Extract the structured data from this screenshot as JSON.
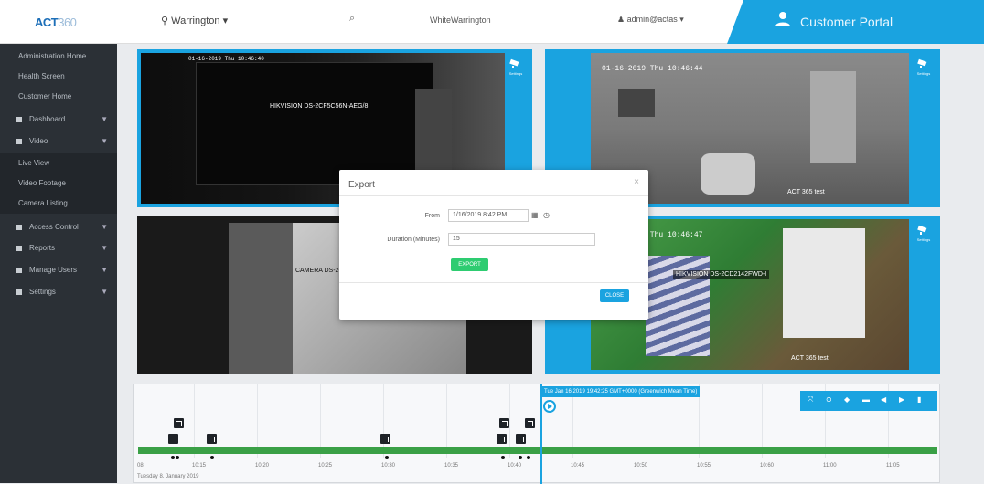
{
  "brand": {
    "logo_main": "ACT",
    "logo_sub": "360"
  },
  "header": {
    "location": "Warrington",
    "location_name": "WhiteWarrington",
    "user": "admin@actas",
    "portal_label": "Customer Portal"
  },
  "sidebar": {
    "items": [
      {
        "label": "Administration Home"
      },
      {
        "label": "Health Screen"
      },
      {
        "label": "Customer Home"
      },
      {
        "label": "Dashboard"
      },
      {
        "label": "Video"
      },
      {
        "label": "Live View"
      },
      {
        "label": "Video Footage"
      },
      {
        "label": "Camera Listing"
      },
      {
        "label": "Access Control"
      },
      {
        "label": "Reports"
      },
      {
        "label": "Manage Users"
      },
      {
        "label": "Settings"
      }
    ]
  },
  "tiles": [
    {
      "timestamp": "01-16-2019 Thu 10:46:40",
      "name": "HIKVISION DS-2CF5C56N-AEG/8",
      "cam_label": "Settings"
    },
    {
      "timestamp": "01-16-2019 Thu 10:46:44",
      "name": "ACT 365 test",
      "cam_label": "Settings"
    },
    {
      "timestamp": "",
      "name": "CAMERA DS-2CD",
      "cam_label": ""
    },
    {
      "timestamp": "01-16-2019 Thu 10:46:47",
      "name": "HIKVISION DS-2CD2142FWD-I",
      "cam_label": "Settings",
      "overlay2": "ACT 365 test"
    }
  ],
  "dialog": {
    "title": "Export",
    "close": "×",
    "from_label": "From",
    "from_value": "1/16/2019 8:42 PM",
    "duration_label": "Duration (Minutes)",
    "duration_value": "15",
    "export_button": "EXPORT",
    "close_button": "CLOSE"
  },
  "timeline": {
    "cursor_label": "Tue Jan 16 2019 19:42:25 GMT+0000 (Greenwich Mean Time)",
    "date_label": "Tuesday 8. January 2019",
    "ticks": [
      "08:",
      "10:15",
      "10:20",
      "10:25",
      "10:30",
      "10:35",
      "10:40",
      "10:45",
      "10:50",
      "10:55",
      "10:60",
      "11:00",
      "11:05"
    ],
    "controls": [
      "⤧",
      "⊙",
      "◆",
      "▬",
      "◀",
      "▶",
      "▮"
    ]
  },
  "colors": {
    "accent": "#1aa3e0",
    "sidebar": "#2b3036",
    "timeline_bar": "#3aa046",
    "export_btn": "#2ecc71"
  }
}
